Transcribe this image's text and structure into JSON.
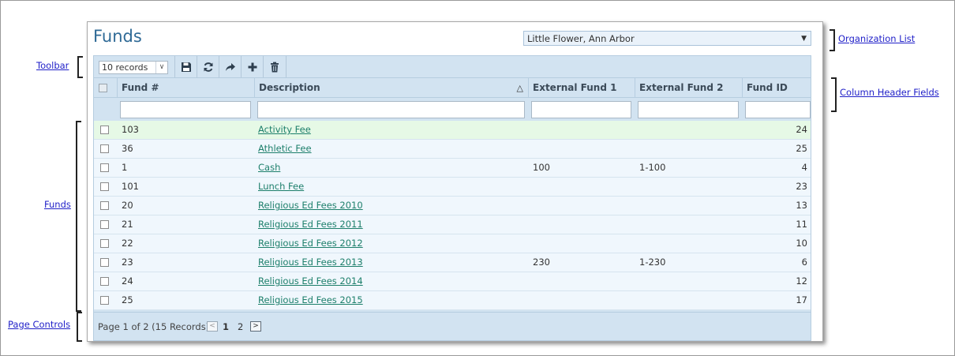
{
  "title": "Funds",
  "organization": {
    "selected": "Little Flower, Ann Arbor"
  },
  "toolbar": {
    "records_select": "10 records",
    "buttons": [
      "save-icon",
      "refresh-icon",
      "share-icon",
      "add-icon",
      "delete-icon"
    ]
  },
  "columns": {
    "fund_num": "Fund #",
    "description": "Description",
    "external_fund_1": "External Fund 1",
    "external_fund_2": "External Fund 2",
    "fund_id": "Fund ID"
  },
  "rows": [
    {
      "fund_num": "103",
      "description": "Activity Fee",
      "ext1": "",
      "ext2": "",
      "fund_id": "24"
    },
    {
      "fund_num": "36",
      "description": "Athletic Fee",
      "ext1": "",
      "ext2": "",
      "fund_id": "25"
    },
    {
      "fund_num": "1",
      "description": "Cash",
      "ext1": "100",
      "ext2": "1-100",
      "fund_id": "4"
    },
    {
      "fund_num": "101",
      "description": "Lunch Fee",
      "ext1": "",
      "ext2": "",
      "fund_id": "23"
    },
    {
      "fund_num": "20",
      "description": "Religious Ed Fees 2010",
      "ext1": "",
      "ext2": "",
      "fund_id": "13"
    },
    {
      "fund_num": "21",
      "description": "Religious Ed Fees 2011",
      "ext1": "",
      "ext2": "",
      "fund_id": "11"
    },
    {
      "fund_num": "22",
      "description": "Religious Ed Fees 2012",
      "ext1": "",
      "ext2": "",
      "fund_id": "10"
    },
    {
      "fund_num": "23",
      "description": "Religious Ed Fees 2013",
      "ext1": "230",
      "ext2": "1-230",
      "fund_id": "6"
    },
    {
      "fund_num": "24",
      "description": "Religious Ed Fees 2014",
      "ext1": "",
      "ext2": "",
      "fund_id": "12"
    },
    {
      "fund_num": "25",
      "description": "Religious Ed Fees 2015",
      "ext1": "",
      "ext2": "",
      "fund_id": "17"
    }
  ],
  "pager": {
    "summary": "Page 1 of 2 (15 Records)",
    "pages": [
      "1",
      "2"
    ],
    "prev": "<",
    "next": ">"
  },
  "callouts": {
    "organization_list": "Organization List",
    "toolbar": "Toolbar",
    "column_header_fields": "Column Header Fields",
    "funds": "Funds",
    "page_controls": "Page Controls"
  },
  "colors": {
    "title": "#2f6a96",
    "grid_bg": "#d2e3f1",
    "row_bg": "#f0f7fd",
    "highlight_row": "#e6f9e6",
    "link": "#1d7f6b",
    "callout_link": "#1f1fc8"
  }
}
